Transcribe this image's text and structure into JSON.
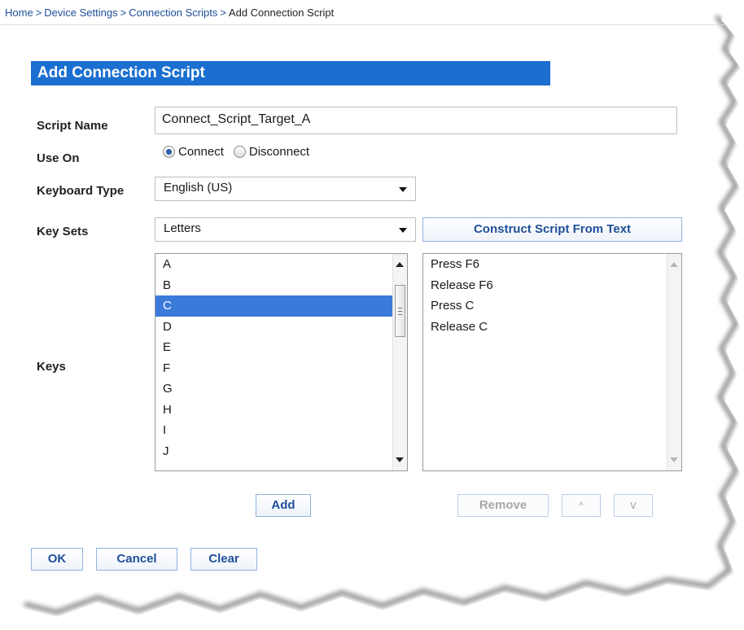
{
  "breadcrumb": {
    "items": [
      "Home",
      "Device Settings",
      "Connection Scripts"
    ],
    "separator": ">",
    "current": "Add Connection Script"
  },
  "section_title": "Add Connection Script",
  "form": {
    "script_name": {
      "label": "Script Name",
      "value": "Connect_Script_Target_A"
    },
    "use_on": {
      "label": "Use On",
      "options": [
        "Connect",
        "Disconnect"
      ],
      "selected": "Connect"
    },
    "keyboard_type": {
      "label": "Keyboard Type",
      "value": "English (US)"
    },
    "key_sets": {
      "label": "Key Sets",
      "value": "Letters"
    },
    "construct_button": "Construct Script From Text",
    "keys": {
      "label": "Keys",
      "items": [
        "A",
        "B",
        "C",
        "D",
        "E",
        "F",
        "G",
        "H",
        "I",
        "J"
      ],
      "selected": "C"
    },
    "script_steps": [
      "Press F6",
      "Release F6",
      "Press C",
      "Release C"
    ]
  },
  "buttons": {
    "add": "Add",
    "remove": "Remove",
    "move_up": "^",
    "move_down": "v",
    "ok": "OK",
    "cancel": "Cancel",
    "clear": "Clear"
  },
  "colors": {
    "header_bg": "#1b6fd1",
    "link": "#1f4e99",
    "selection": "#3a7ad9"
  }
}
